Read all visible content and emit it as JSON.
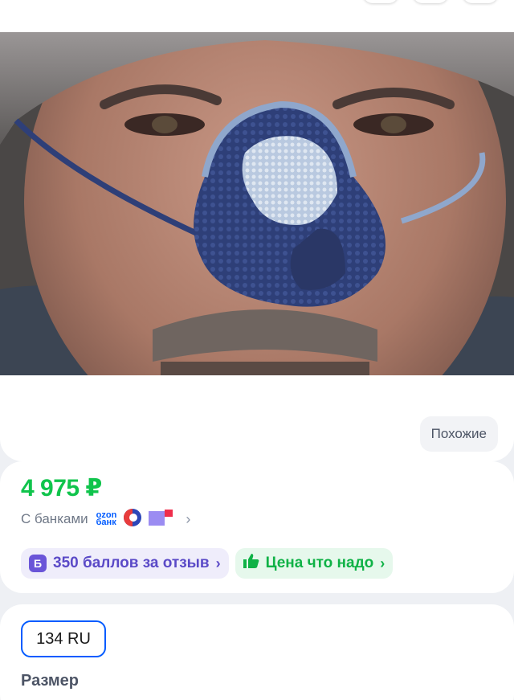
{
  "similar": {
    "label": "Похожие"
  },
  "price": {
    "value": "4 975 ₽",
    "color": "#10c44c"
  },
  "banks": {
    "label": "С банками",
    "ozon_line1": "ozon",
    "ozon_line2": "банк"
  },
  "badges": {
    "points_icon": "Б",
    "points_label": "350 баллов за отзыв",
    "price_label": "Цена что надо",
    "chevron": "›"
  },
  "size": {
    "selected": "134 RU",
    "label": "Размер"
  },
  "colors": {
    "accent": "#005bff",
    "points": "#5a49c7",
    "green": "#0fb246"
  },
  "icons": [
    "thumbs-up-icon",
    "chevron-right-icon",
    "bank-icon",
    "points-icon"
  ]
}
